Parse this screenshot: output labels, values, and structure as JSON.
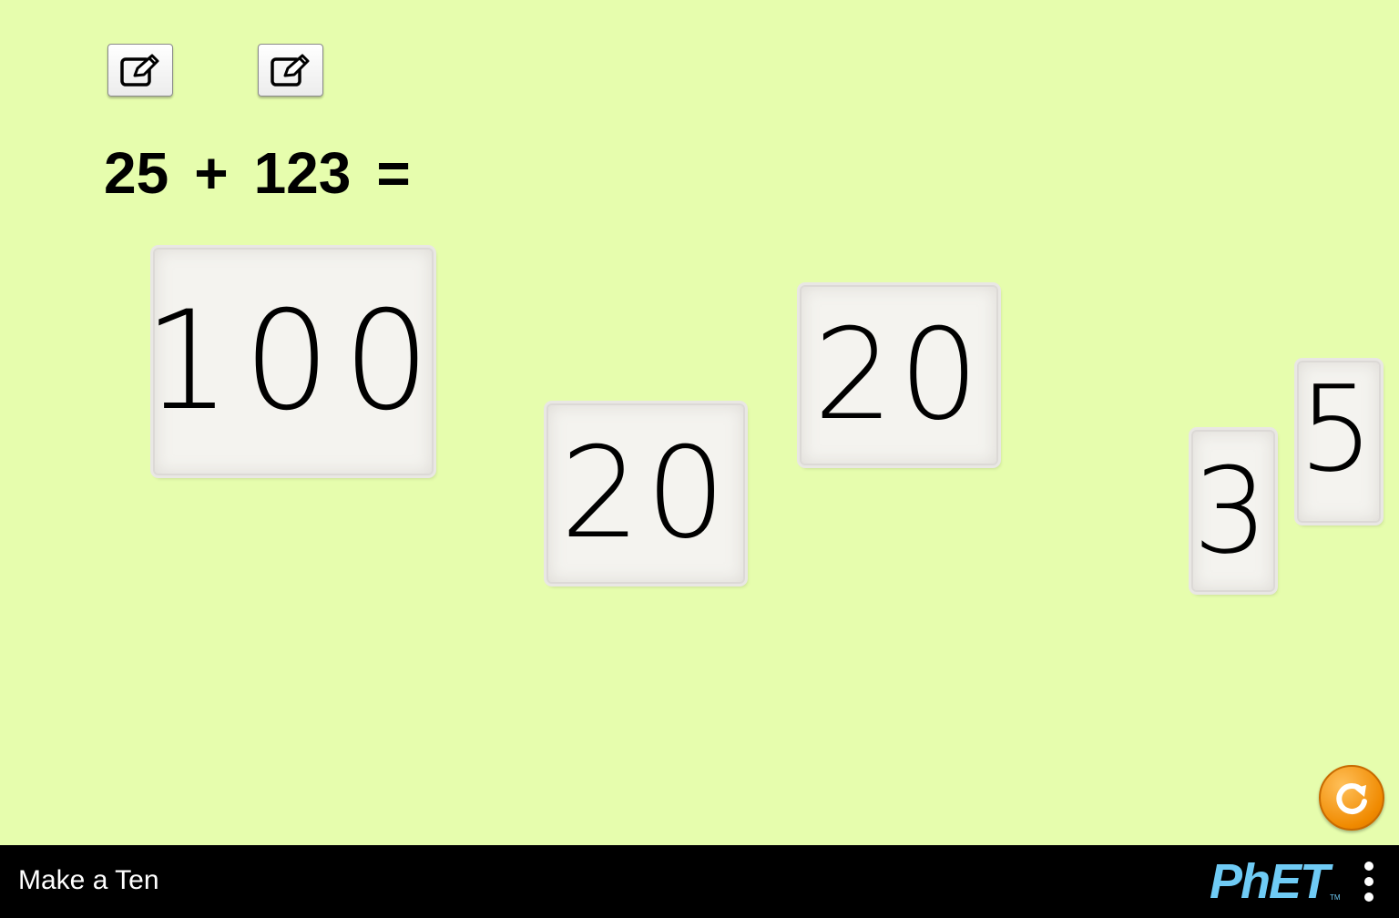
{
  "equation": {
    "left_operand": "25",
    "plus": "+",
    "right_operand": "123",
    "equals": "="
  },
  "cards": [
    {
      "value": "100"
    },
    {
      "value": "20"
    },
    {
      "value": "20"
    },
    {
      "value": "3"
    },
    {
      "value": "5"
    }
  ],
  "icons": {
    "edit_left": "edit-icon",
    "edit_right": "edit-icon",
    "reset": "reset-icon",
    "menu": "menu-icon"
  },
  "navbar": {
    "title": "Make a Ten",
    "logo_text": "PhET",
    "logo_tm": "TM"
  },
  "colors": {
    "background": "#e6fdad",
    "navbar": "#000000",
    "reset_accent": "#f08a00",
    "logo": "#6fcbf5"
  }
}
